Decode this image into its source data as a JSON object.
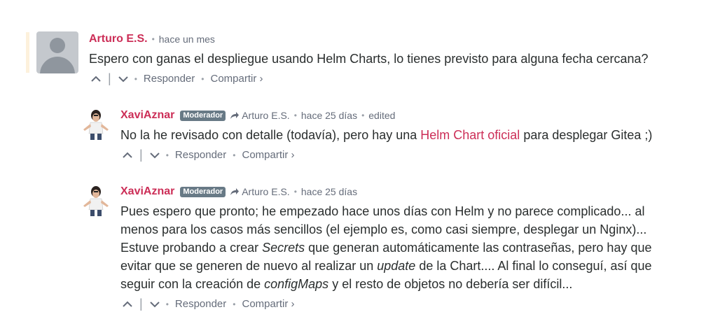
{
  "comments": [
    {
      "author": "Arturo E.S.",
      "time": "hace un mes",
      "text": "Espero con ganas el despliegue usando Helm Charts, lo tienes previsto para alguna fecha cercana?",
      "reply": "Responder",
      "share": "Compartir ›"
    },
    {
      "author": "XaviAznar",
      "badge": "Moderador",
      "reply_to": "Arturo E.S.",
      "time": "hace 25 días",
      "edited": "edited",
      "text_before": "No la he revisado con detalle (todavía), pero hay una ",
      "link": "Helm Chart oficial",
      "text_after": " para desplegar Gitea ;)",
      "reply": "Responder",
      "share": "Compartir ›"
    },
    {
      "author": "XaviAznar",
      "badge": "Moderador",
      "reply_to": "Arturo E.S.",
      "time": "hace 25 días",
      "line1": "Pues espero que pronto; he empezado hace unos días con Helm y no parece complicado... al",
      "line2": "menos para los casos más sencillos (el ejemplo es, como casi siempre, desplegar un Nginx)...",
      "line3a": "Estuve probando a crear ",
      "line3i": "Secrets",
      "line3b": " que generan automáticamente las contraseñas, pero hay que",
      "line4a": "evitar que se generen de nuevo al realizar un ",
      "line4i": "update",
      "line4b": " de la Chart.... Al final lo conseguí, así que",
      "line5a": "seguir con la creación de ",
      "line5i": "configMaps",
      "line5b": " y el resto de objetos no debería ser difícil...",
      "reply": "Responder",
      "share": "Compartir ›"
    }
  ],
  "icons": {
    "upvote": "chevron-up-icon",
    "downvote": "chevron-down-icon",
    "reply_arrow": "reply-arrow-icon"
  },
  "colors": {
    "author": "#cc2e57",
    "link": "#cc2e57",
    "badge_bg": "#687a86",
    "meta": "#656c7a",
    "accent_bar": "#fdf1dc"
  }
}
